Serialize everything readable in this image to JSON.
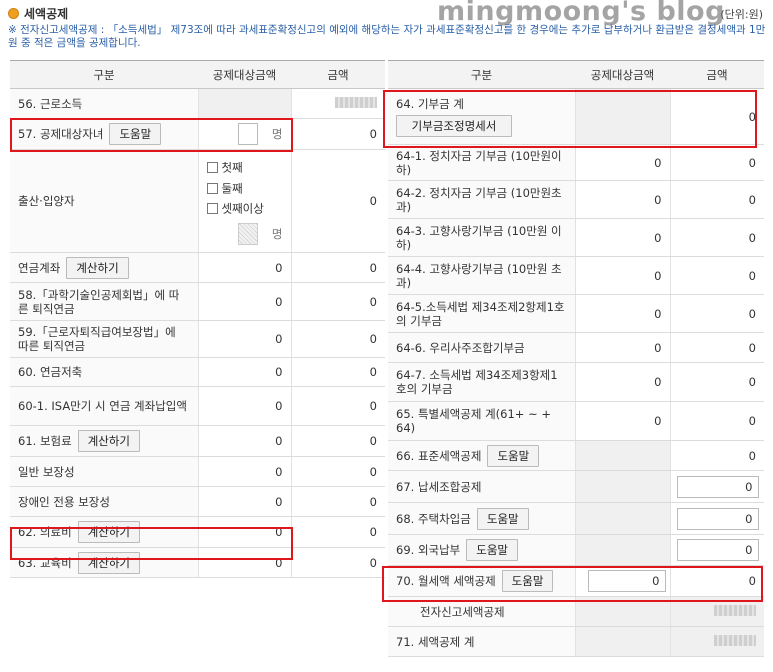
{
  "header": {
    "title": "세액공제",
    "unit": "(단위:원)",
    "watermark": "mingmoong's blog"
  },
  "note": "※ 전자신고세액공제 : 「소득세법」 제73조에 따라 과세표준확정신고의 예외에 해당하는 자가 과세표준확정신고를 한 경우에는 추가로 납부하거나 환급받은 결정세액과 1만원 중 적은 금액을 공제합니다.",
  "columns": {
    "category": "구분",
    "base": "공제대상금액",
    "amount": "금액"
  },
  "left": {
    "r56": {
      "label": "56. 근로소득"
    },
    "r57": {
      "label": "57. 공제대상자녀",
      "button": "도움말",
      "unit": "명",
      "amount": "0"
    },
    "birth": {
      "label": "출산·입양자",
      "opt1": "첫째",
      "opt2": "둘째",
      "opt3": "셋째이상",
      "unit": "명",
      "amount": "0"
    },
    "pension": {
      "label": "연금계좌",
      "button": "계산하기",
      "base": "0",
      "amount": "0"
    },
    "r58": {
      "label": "58.「과학기술인공제회법」에 따른 퇴직연금",
      "base": "0",
      "amount": "0"
    },
    "r59": {
      "label": "59.「근로자퇴직급여보장법」에 따른 퇴직연금",
      "base": "0",
      "amount": "0"
    },
    "r60": {
      "label": "60. 연금저축",
      "base": "0",
      "amount": "0"
    },
    "r60_1": {
      "label": "60-1. ISA만기 시 연금 계좌납입액",
      "base": "0",
      "amount": "0"
    },
    "r61": {
      "label": "61. 보험료",
      "button": "계산하기",
      "base": "0",
      "amount": "0"
    },
    "general": {
      "label": "일반 보장성",
      "base": "0",
      "amount": "0"
    },
    "disabled": {
      "label": "장애인 전용 보장성",
      "base": "0",
      "amount": "0"
    },
    "r62": {
      "label": "62. 의료비",
      "button": "계산하기",
      "base": "0",
      "amount": "0"
    },
    "r63": {
      "label": "63. 교육비",
      "button": "계산하기",
      "base": "0",
      "amount": "0"
    }
  },
  "right": {
    "r64": {
      "label": "64. 기부금 계",
      "button": "기부금조정명세서",
      "amount": "0"
    },
    "r64_1": {
      "label": "64-1. 정치자금 기부금 (10만원이하)",
      "base": "0",
      "amount": "0"
    },
    "r64_2": {
      "label": "64-2. 정치자금 기부금 (10만원초과)",
      "base": "0",
      "amount": "0"
    },
    "r64_3": {
      "label": "64-3. 고향사랑기부금 (10만원 이하)",
      "base": "0",
      "amount": "0"
    },
    "r64_4": {
      "label": "64-4. 고향사랑기부금 (10만원 초과)",
      "base": "0",
      "amount": "0"
    },
    "r64_5": {
      "label": "64-5.소득세법 제34조제2항제1호의 기부금",
      "base": "0",
      "amount": "0"
    },
    "r64_6": {
      "label": "64-6. 우리사주조합기부금",
      "base": "0",
      "amount": "0"
    },
    "r64_7": {
      "label": "64-7. 소득세법 제34조제3항제1호의 기부금",
      "base": "0",
      "amount": "0"
    },
    "r65": {
      "label": "65. 특별세액공제 계(61+ ~ + 64)",
      "base": "0",
      "amount": "0"
    },
    "r66": {
      "label": "66. 표준세액공제",
      "button": "도움말",
      "amount": "0"
    },
    "r67": {
      "label": "67. 납세조합공제",
      "input": "0"
    },
    "r68": {
      "label": "68. 주택차입금",
      "button": "도움말",
      "input": "0"
    },
    "r69": {
      "label": "69. 외국납부",
      "button": "도움말",
      "input": "0"
    },
    "r70": {
      "label": "70. 월세액 세액공제",
      "button": "도움말",
      "base_input": "0",
      "amount": "0"
    },
    "e_filing": {
      "label": "전자신고세액공제"
    },
    "r71": {
      "label": "71. 세액공제 계"
    }
  }
}
